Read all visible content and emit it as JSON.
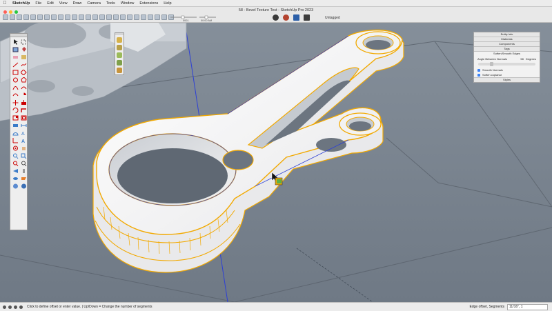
{
  "menubar": {
    "app": "SketchUp",
    "items": [
      "File",
      "Edit",
      "View",
      "Draw",
      "Camera",
      "Tools",
      "Window",
      "Extensions",
      "Help"
    ]
  },
  "window": {
    "title": "58 - Bevel Texture Test - SketchUp Pro 2023",
    "tag_selector": "Untagged",
    "traffic_colors": [
      "#ff5f57",
      "#febc2e",
      "#28c840"
    ],
    "slider_labels": [
      "0001",
      "00:00 AM"
    ]
  },
  "tray": {
    "panels": [
      "Entity Info",
      "Materials",
      "Components",
      "Tags"
    ],
    "soften_title": "Soften/Smooth Edges",
    "angle_label": "Angle Between Normals",
    "angle_value": "58",
    "angle_unit": "Degrees",
    "smooth_normals": "Smooth Normals",
    "soften_coplanar": "Soften coplanar",
    "styles": "Styles"
  },
  "statusbar": {
    "message": "Click to define offset or enter value. | Up/Down = Change the number of segments",
    "vcb_label": "Edge offset, Segments",
    "vcb_value": "11/16\", 1"
  },
  "colors": {
    "viewport_bg": "#7b8591",
    "selection": "#f2a900",
    "model_face": "#f6f6f6",
    "axis_blue": "#2c3fd6"
  }
}
